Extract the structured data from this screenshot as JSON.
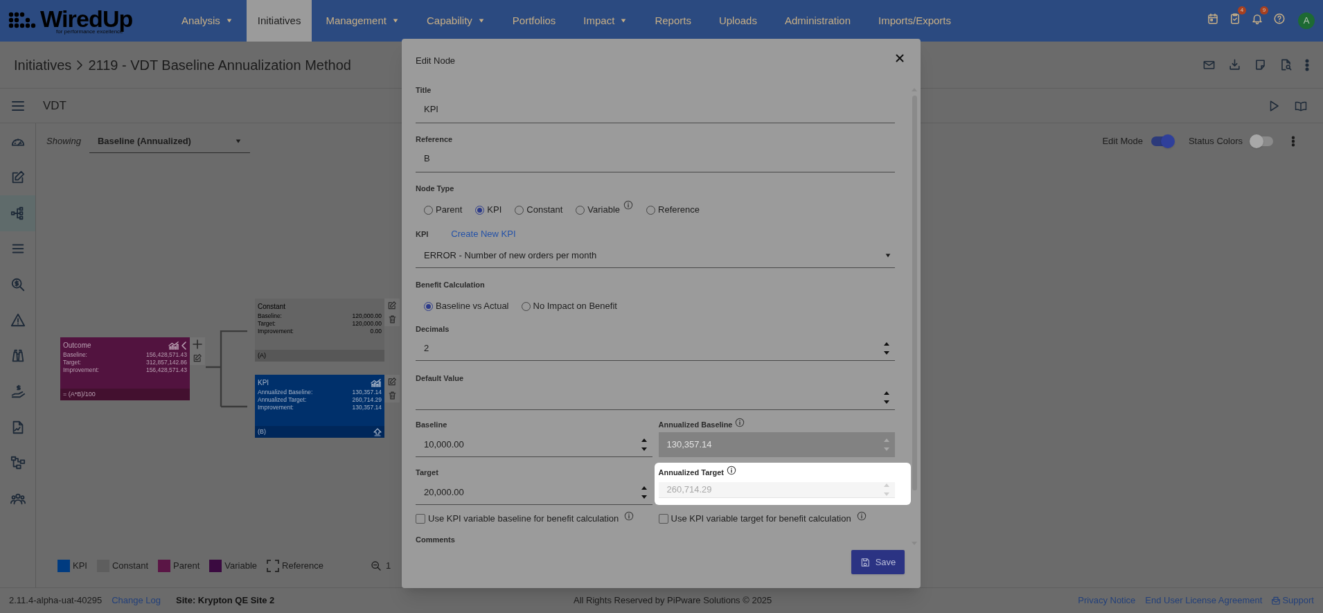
{
  "top_nav": {
    "logo": {
      "name": "WiredUp",
      "tagline": "for performance excellence"
    },
    "items": [
      {
        "label": "Analysis",
        "dropdown": true,
        "selected": false
      },
      {
        "label": "Initiatives",
        "dropdown": false,
        "selected": true
      },
      {
        "label": "Management",
        "dropdown": true,
        "selected": false
      },
      {
        "label": "Capability",
        "dropdown": true,
        "selected": false
      },
      {
        "label": "Portfolios",
        "dropdown": false,
        "selected": false
      },
      {
        "label": "Impact",
        "dropdown": true,
        "selected": false
      },
      {
        "label": "Reports",
        "dropdown": false,
        "selected": false
      },
      {
        "label": "Uploads",
        "dropdown": false,
        "selected": false
      },
      {
        "label": "Administration",
        "dropdown": false,
        "selected": false
      },
      {
        "label": "Imports/Exports",
        "dropdown": false,
        "selected": false
      }
    ],
    "tasks_badge": "4",
    "alerts_badge": "9",
    "avatar": "A"
  },
  "breadcrumb": {
    "parent": "Initiatives",
    "current": "2119 - VDT Baseline Annualization Method"
  },
  "page_title": "VDT",
  "sidebar": {
    "items": [
      {
        "selected": false
      },
      {
        "selected": false
      },
      {
        "selected": true
      },
      {
        "selected": false
      },
      {
        "selected": false
      },
      {
        "selected": false
      },
      {
        "selected": false
      },
      {
        "selected": false
      },
      {
        "selected": false
      },
      {
        "selected": false
      },
      {
        "selected": false
      }
    ]
  },
  "showing": {
    "label": "Showing",
    "value": "Baseline (Annualized)"
  },
  "toggles": [
    {
      "label": "Edit Mode",
      "on": true
    },
    {
      "label": "Status Colors",
      "on": false
    }
  ],
  "nodes": [
    {
      "kind": "parent",
      "title": "Outcome",
      "rows": [
        {
          "label": "Baseline:",
          "value": "156,428,571.43"
        },
        {
          "label": "Target:",
          "value": "312,857,142.86"
        },
        {
          "label": "Improvement:",
          "value": "156,428,571.43"
        }
      ],
      "footer": "= (A*B)/100"
    },
    {
      "kind": "constant",
      "title": "Constant",
      "rows": [
        {
          "label": "Baseline:",
          "value": "120,000.00"
        },
        {
          "label": "Target:",
          "value": "120,000.00"
        },
        {
          "label": "Improvement:",
          "value": "0.00"
        }
      ],
      "footer": "(A)"
    },
    {
      "kind": "kpi",
      "title": "KPI",
      "rows": [
        {
          "label": "Annualized Baseline:",
          "value": "130,357.14"
        },
        {
          "label": "Annualized Target:",
          "value": "260,714.29"
        },
        {
          "label": "Improvement:",
          "value": "130,357.14"
        }
      ],
      "footer": "(B)"
    }
  ],
  "legend": [
    {
      "label": "KPI",
      "kind": "swatch",
      "color": "#003b80"
    },
    {
      "label": "Constant",
      "kind": "swatch",
      "color": "#5e5e5e"
    },
    {
      "label": "Parent",
      "kind": "swatch",
      "color": "#5a1545"
    },
    {
      "label": "Variable",
      "kind": "swatch",
      "color": "#3a0a40"
    },
    {
      "label": "Reference",
      "kind": "dashed"
    }
  ],
  "zoom_level": "1",
  "dialog": {
    "title": "Edit Node",
    "title_field": {
      "label": "Title",
      "value": "KPI"
    },
    "reference_field": {
      "label": "Reference",
      "value": "B"
    },
    "node_type": {
      "label": "Node Type",
      "options": [
        {
          "label": "Parent",
          "selected": false,
          "info": false
        },
        {
          "label": "KPI",
          "selected": true,
          "info": false
        },
        {
          "label": "Constant",
          "selected": false,
          "info": false
        },
        {
          "label": "Variable",
          "selected": false,
          "info": true
        },
        {
          "label": "Reference",
          "selected": false,
          "info": false
        }
      ]
    },
    "kpi": {
      "label": "KPI",
      "link": "Create New KPI",
      "value": "ERROR - Number of new orders per month"
    },
    "benefit_calculation": {
      "label": "Benefit Calculation",
      "options": [
        {
          "label": "Baseline vs Actual",
          "selected": true
        },
        {
          "label": "No Impact on Benefit",
          "selected": false
        }
      ]
    },
    "decimals": {
      "label": "Decimals",
      "value": "2"
    },
    "default_value": {
      "label": "Default Value"
    },
    "values": [
      {
        "label": "Baseline",
        "value": "10,000.00",
        "disabled": false,
        "info": false,
        "highlighted": false
      },
      {
        "label": "Annualized Baseline",
        "value": "130,357.14",
        "disabled": true,
        "info": true,
        "highlighted": false
      },
      {
        "label": "Target",
        "value": "20,000.00",
        "disabled": false,
        "info": false,
        "highlighted": false
      },
      {
        "label": "Annualized Target",
        "value": "260,714.29",
        "disabled": true,
        "info": true,
        "highlighted": true
      }
    ],
    "checkboxes": [
      {
        "label": "Use KPI variable baseline for benefit calculation",
        "checked": false
      },
      {
        "label": "Use KPI variable target for benefit calculation",
        "checked": false
      }
    ],
    "comments_label": "Comments",
    "save": "Save"
  },
  "footer": {
    "version": "2.11.4-alpha-uat-40295",
    "change_log": "Change Log",
    "site": "Site: Krypton QE Site 2",
    "copyright": "All Rights Reserved by PiPware Solutions © 2025",
    "links": [
      "Privacy Notice",
      "End User License Agreement"
    ],
    "support": "Support"
  }
}
